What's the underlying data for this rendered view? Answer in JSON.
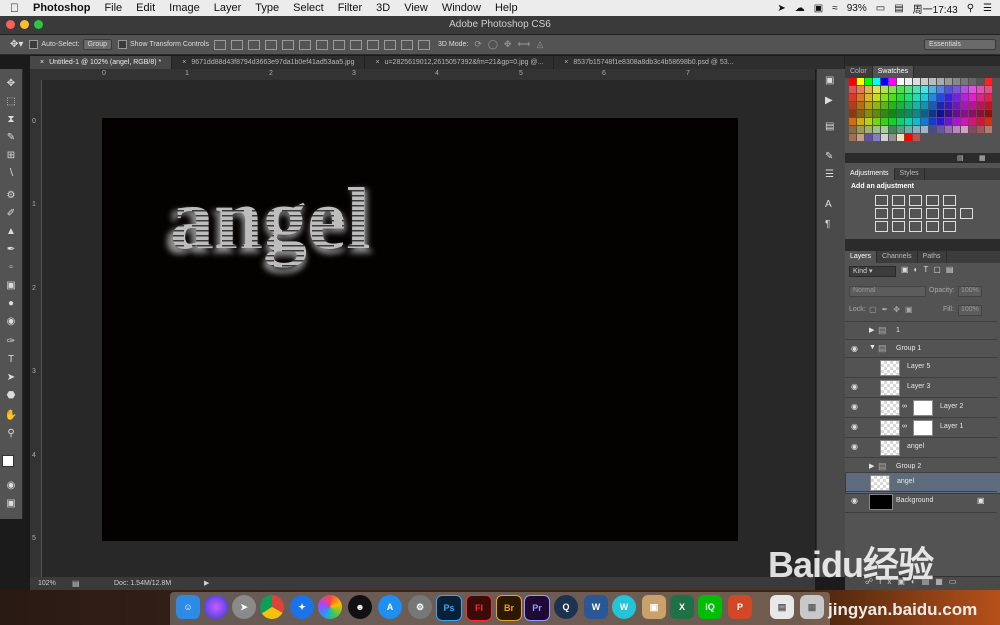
{
  "menubar": {
    "app_name": "Photoshop",
    "items": [
      "File",
      "Edit",
      "Image",
      "Layer",
      "Type",
      "Select",
      "Filter",
      "3D",
      "View",
      "Window",
      "Help"
    ],
    "battery": "93%",
    "clock": "周一17:43"
  },
  "window": {
    "title": "Adobe Photoshop CS6"
  },
  "options": {
    "auto_select_label": "Auto-Select:",
    "auto_select_value": "Group",
    "show_transform_label": "Show Transform Controls",
    "mode3d_label": "3D Mode:",
    "workspace": "Essentials"
  },
  "tabs": [
    "Untitled-1 @ 102% (angel, RGB/8) *",
    "9671dd88d43f8794d3663e97da1b0ef41ad53aa5.jpg",
    "u=2825619012,2615057392&fm=21&gp=0.jpg @...",
    "8537b15748f1e8308a8db3c4b58698b0.psd @ 53..."
  ],
  "ruler": {
    "top": [
      "0",
      "1",
      "2",
      "3",
      "4",
      "5",
      "6",
      "7"
    ],
    "left": [
      "0",
      "1",
      "2",
      "3",
      "4",
      "5"
    ]
  },
  "canvas": {
    "text": "angel"
  },
  "status": {
    "zoom": "102%",
    "doc": "Doc: 1.54M/12.8M"
  },
  "color_panel": {
    "tabs": [
      "Color",
      "Swatches"
    ]
  },
  "adjustments": {
    "tabs": [
      "Adjustments",
      "Styles"
    ],
    "heading": "Add an adjustment"
  },
  "layers_panel": {
    "tabs": [
      "Layers",
      "Channels",
      "Paths"
    ],
    "kind": "Kind",
    "blend": "Normal",
    "opacity_label": "Opacity:",
    "opacity": "100%",
    "lock_label": "Lock:",
    "fill_label": "Fill:",
    "fill": "100%",
    "layers": [
      {
        "name": "1",
        "type": "group"
      },
      {
        "name": "Group 1",
        "type": "group-open"
      },
      {
        "name": "Layer 5",
        "type": "layer"
      },
      {
        "name": "Layer 3",
        "type": "layer"
      },
      {
        "name": "Layer 2",
        "type": "masked"
      },
      {
        "name": "Layer 1",
        "type": "masked"
      },
      {
        "name": "angel",
        "type": "layer"
      },
      {
        "name": "Group 2",
        "type": "group"
      },
      {
        "name": "angel",
        "type": "layer-selected"
      },
      {
        "name": "Background",
        "type": "background"
      }
    ]
  },
  "dock": {
    "apps": [
      "Finder",
      "Siri",
      "Launchpad",
      "Chrome",
      "Safari",
      "Photos",
      "QQ",
      "App Store",
      "System Preferences",
      "Ps",
      "Fl",
      "Br",
      "Pr",
      "QuickTime",
      "Word",
      "WPS",
      "Archive",
      "Excel",
      "iQIYI",
      "PowerPoint",
      "Preview",
      "Trash"
    ]
  },
  "watermark": {
    "logo": "Baidu经验",
    "url": "jingyan.baidu.com"
  }
}
